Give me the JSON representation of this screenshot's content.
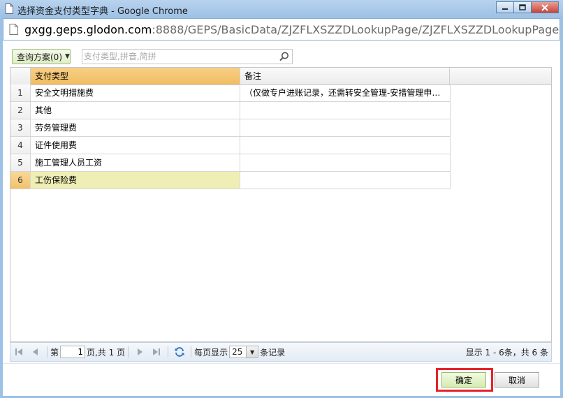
{
  "window": {
    "title": "选择资金支付类型字典 - Google Chrome",
    "url_host": "gxgg.geps.glodon.com",
    "url_rest": ":8888/GEPS/BasicData/ZJZFLXSZZDLookupPage/ZJZFLXSZZDLookupPage.aspx"
  },
  "toolbar": {
    "query_label": "查询方案(0)",
    "search_placeholder": "支付类型,拼音,简拼"
  },
  "grid": {
    "columns": [
      "支付类型",
      "备注"
    ],
    "rows": [
      {
        "num": "1",
        "type": "安全文明措施费",
        "note": "（仅做专户进账记录，还需转安全管理-安措管理申…"
      },
      {
        "num": "2",
        "type": "其他",
        "note": ""
      },
      {
        "num": "3",
        "type": "劳务管理费",
        "note": ""
      },
      {
        "num": "4",
        "type": "证件使用费",
        "note": ""
      },
      {
        "num": "5",
        "type": "施工管理人员工资",
        "note": ""
      },
      {
        "num": "6",
        "type": "工伤保险费",
        "note": ""
      }
    ],
    "selected_row": 6
  },
  "pager": {
    "page_prefix": "第",
    "page_value": "1",
    "page_suffix": "页,共 1 页",
    "size_prefix": "每页显示",
    "size_value": "25",
    "size_suffix": "条记录",
    "info": "显示 1 - 6条，共 6 条"
  },
  "footer": {
    "ok_label": "确定",
    "cancel_label": "取消"
  },
  "colors": {
    "header_selected": "#f1bd62",
    "row_selected": "#efefb5",
    "highlight": "#e5232b"
  }
}
